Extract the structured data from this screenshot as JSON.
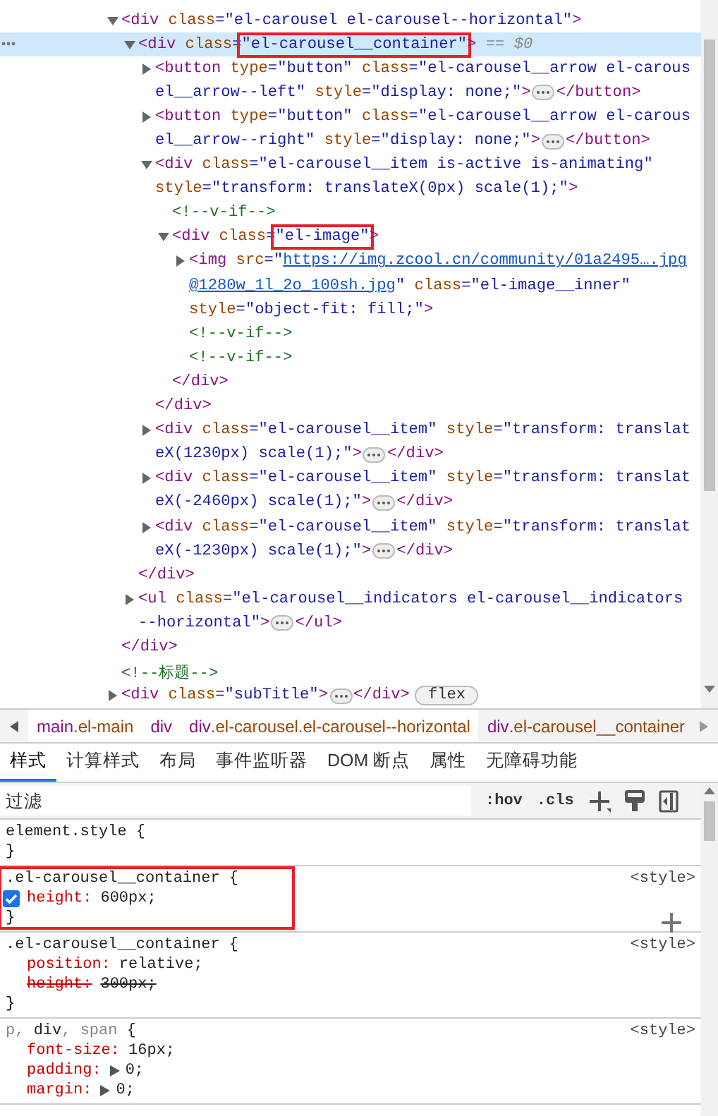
{
  "dom_tree": [
    {
      "kind": "element",
      "selected": false,
      "expanded": true,
      "lines": [
        [
          {
            "kind": "tag",
            "text": "<div"
          },
          {
            "kind": "attr",
            "text": " class"
          },
          {
            "kind": "value",
            "text": "=\"el-carousel el-carousel--horizontal\""
          },
          {
            "kind": "tag",
            "text": ">"
          }
        ]
      ],
      "children": [
        {
          "kind": "element",
          "selected": true,
          "expanded": true,
          "lines": [
            [
              {
                "kind": "tag",
                "text": "<div"
              },
              {
                "kind": "attr",
                "text": " class"
              },
              {
                "kind": "value",
                "text": "="
              },
              {
                "kind": "value",
                "text": "\"el-carousel__container\"",
                "outlined": true
              },
              {
                "kind": "tag",
                "text": ">"
              },
              {
                "kind": "marker",
                "text": " == $0"
              }
            ]
          ],
          "children": [
            {
              "kind": "element",
              "selected": false,
              "expanded": false,
              "lines": [
                [
                  {
                    "kind": "tag",
                    "text": "<button"
                  },
                  {
                    "kind": "attr",
                    "text": " type"
                  },
                  {
                    "kind": "value",
                    "text": "=\"button\""
                  },
                  {
                    "kind": "attr",
                    "text": " class"
                  },
                  {
                    "kind": "value",
                    "text": "=\"el-carousel__arrow el-carous"
                  }
                ],
                [
                  {
                    "kind": "value",
                    "text": "el__arrow--left\""
                  },
                  {
                    "kind": "attr",
                    "text": " style"
                  },
                  {
                    "kind": "value",
                    "text": "=\"display: none;\""
                  },
                  {
                    "kind": "tag",
                    "text": ">"
                  },
                  {
                    "kind": "ellipsis"
                  },
                  {
                    "kind": "tag",
                    "text": "</button>"
                  }
                ]
              ]
            },
            {
              "kind": "element",
              "selected": false,
              "expanded": false,
              "lines": [
                [
                  {
                    "kind": "tag",
                    "text": "<button"
                  },
                  {
                    "kind": "attr",
                    "text": " type"
                  },
                  {
                    "kind": "value",
                    "text": "=\"button\""
                  },
                  {
                    "kind": "attr",
                    "text": " class"
                  },
                  {
                    "kind": "value",
                    "text": "=\"el-carousel__arrow el-carous"
                  }
                ],
                [
                  {
                    "kind": "value",
                    "text": "el__arrow--right\""
                  },
                  {
                    "kind": "attr",
                    "text": " style"
                  },
                  {
                    "kind": "value",
                    "text": "=\"display: none;\""
                  },
                  {
                    "kind": "tag",
                    "text": ">"
                  },
                  {
                    "kind": "ellipsis"
                  },
                  {
                    "kind": "tag",
                    "text": "</button>"
                  }
                ]
              ]
            },
            {
              "kind": "element",
              "selected": false,
              "expanded": true,
              "lines": [
                [
                  {
                    "kind": "tag",
                    "text": "<div"
                  },
                  {
                    "kind": "attr",
                    "text": " class"
                  },
                  {
                    "kind": "value",
                    "text": "=\"el-carousel__item is-active is-animating\""
                  }
                ],
                [
                  {
                    "kind": "attr",
                    "text": "style"
                  },
                  {
                    "kind": "value",
                    "text": "=\"transform: translateX(0px) scale(1);\""
                  },
                  {
                    "kind": "tag",
                    "text": ">"
                  }
                ]
              ],
              "children": [
                {
                  "kind": "comment",
                  "selected": false,
                  "lines": [
                    [
                      {
                        "kind": "comment",
                        "text": "<!--v-if-->"
                      }
                    ]
                  ]
                },
                {
                  "kind": "element",
                  "selected": false,
                  "expanded": true,
                  "lines": [
                    [
                      {
                        "kind": "tag",
                        "text": "<div"
                      },
                      {
                        "kind": "attr",
                        "text": " class"
                      },
                      {
                        "kind": "value",
                        "text": "="
                      },
                      {
                        "kind": "value",
                        "text": "\"el-image\"",
                        "outlined": true
                      },
                      {
                        "kind": "tag",
                        "text": ">"
                      }
                    ]
                  ],
                  "children": [
                    {
                      "kind": "element",
                      "selected": false,
                      "expanded": false,
                      "lines": [
                        [
                          {
                            "kind": "tag",
                            "text": "<img"
                          },
                          {
                            "kind": "attr",
                            "text": " src"
                          },
                          {
                            "kind": "value",
                            "text": "=\""
                          },
                          {
                            "kind": "link",
                            "text": "https://img.zcool.cn/community/01a2495….jpg"
                          }
                        ],
                        [
                          {
                            "kind": "link",
                            "text": "@1280w_1l_2o_100sh.jpg"
                          },
                          {
                            "kind": "value",
                            "text": "\""
                          },
                          {
                            "kind": "attr",
                            "text": " class"
                          },
                          {
                            "kind": "value",
                            "text": "=\"el-image__inner\""
                          }
                        ],
                        [
                          {
                            "kind": "attr",
                            "text": "style"
                          },
                          {
                            "kind": "value",
                            "text": "=\"object-fit: fill;\""
                          },
                          {
                            "kind": "tag",
                            "text": ">"
                          }
                        ]
                      ]
                    },
                    {
                      "kind": "comment",
                      "selected": false,
                      "lines": [
                        [
                          {
                            "kind": "comment",
                            "text": "<!--v-if-->"
                          }
                        ]
                      ]
                    },
                    {
                      "kind": "comment",
                      "selected": false,
                      "lines": [
                        [
                          {
                            "kind": "comment",
                            "text": "<!--v-if-->"
                          }
                        ]
                      ]
                    }
                  ],
                  "closing": [
                    {
                      "kind": "tag",
                      "text": "</div>"
                    }
                  ]
                }
              ],
              "closing": [
                {
                  "kind": "tag",
                  "text": "</div>"
                }
              ]
            },
            {
              "kind": "element",
              "selected": false,
              "expanded": false,
              "lines": [
                [
                  {
                    "kind": "tag",
                    "text": "<div"
                  },
                  {
                    "kind": "attr",
                    "text": " class"
                  },
                  {
                    "kind": "value",
                    "text": "=\"el-carousel__item\""
                  },
                  {
                    "kind": "attr",
                    "text": " style"
                  },
                  {
                    "kind": "value",
                    "text": "=\"transform: translat"
                  }
                ],
                [
                  {
                    "kind": "value",
                    "text": "eX(1230px) scale(1);\""
                  },
                  {
                    "kind": "tag",
                    "text": ">"
                  },
                  {
                    "kind": "ellipsis"
                  },
                  {
                    "kind": "tag",
                    "text": "</div>"
                  }
                ]
              ]
            },
            {
              "kind": "element",
              "selected": false,
              "expanded": false,
              "lines": [
                [
                  {
                    "kind": "tag",
                    "text": "<div"
                  },
                  {
                    "kind": "attr",
                    "text": " class"
                  },
                  {
                    "kind": "value",
                    "text": "=\"el-carousel__item\""
                  },
                  {
                    "kind": "attr",
                    "text": " style"
                  },
                  {
                    "kind": "value",
                    "text": "=\"transform: translat"
                  }
                ],
                [
                  {
                    "kind": "value",
                    "text": "eX(-2460px) scale(1);\""
                  },
                  {
                    "kind": "tag",
                    "text": ">"
                  },
                  {
                    "kind": "ellipsis"
                  },
                  {
                    "kind": "tag",
                    "text": "</div>"
                  }
                ]
              ]
            },
            {
              "kind": "element",
              "selected": false,
              "expanded": false,
              "lines": [
                [
                  {
                    "kind": "tag",
                    "text": "<div"
                  },
                  {
                    "kind": "attr",
                    "text": " class"
                  },
                  {
                    "kind": "value",
                    "text": "=\"el-carousel__item\""
                  },
                  {
                    "kind": "attr",
                    "text": " style"
                  },
                  {
                    "kind": "value",
                    "text": "=\"transform: translat"
                  }
                ],
                [
                  {
                    "kind": "value",
                    "text": "eX(-1230px) scale(1);\""
                  },
                  {
                    "kind": "tag",
                    "text": ">"
                  },
                  {
                    "kind": "ellipsis"
                  },
                  {
                    "kind": "tag",
                    "text": "</div>"
                  }
                ]
              ]
            }
          ],
          "closing": [
            {
              "kind": "tag",
              "text": "</div>"
            }
          ]
        },
        {
          "kind": "element",
          "selected": false,
          "expanded": false,
          "lines": [
            [
              {
                "kind": "tag",
                "text": "<ul"
              },
              {
                "kind": "attr",
                "text": " class"
              },
              {
                "kind": "value",
                "text": "=\"el-carousel__indicators el-carousel__indicators"
              }
            ],
            [
              {
                "kind": "value",
                "text": "--horizontal\""
              },
              {
                "kind": "tag",
                "text": ">"
              },
              {
                "kind": "ellipsis"
              },
              {
                "kind": "tag",
                "text": "</ul>"
              }
            ]
          ]
        }
      ],
      "closing": [
        {
          "kind": "tag",
          "text": "</div>"
        }
      ]
    },
    {
      "kind": "comment",
      "selected": false,
      "lines": [
        [
          {
            "kind": "comment",
            "text": "<!--标题-->"
          }
        ]
      ]
    },
    {
      "kind": "element",
      "selected": false,
      "expanded": false,
      "lines": [
        [
          {
            "kind": "tag",
            "text": "<div"
          },
          {
            "kind": "attr",
            "text": " class"
          },
          {
            "kind": "value",
            "text": "=\"subTitle\""
          },
          {
            "kind": "tag",
            "text": ">"
          },
          {
            "kind": "ellipsis"
          },
          {
            "kind": "tag",
            "text": "</div>"
          },
          {
            "kind": "badge",
            "text": "flex"
          }
        ]
      ]
    }
  ],
  "breadcrumbs": [
    {
      "tag": "main",
      "classes": ".el-main",
      "selected": false
    },
    {
      "tag": "div",
      "selected": false
    },
    {
      "tag": "div",
      "classes": ".el-carousel.el-carousel--horizontal",
      "selected": false
    },
    {
      "tag": "div",
      "classes": ".el-carousel__container",
      "selected": true
    }
  ],
  "tabs": [
    {
      "label": "样式",
      "selected": true
    },
    {
      "label": "计算样式",
      "selected": false
    },
    {
      "label": "布局",
      "selected": false
    },
    {
      "label": "事件监听器",
      "selected": false
    },
    {
      "label": "DOM 断点",
      "selected": false
    },
    {
      "label": "属性",
      "selected": false
    },
    {
      "label": "无障碍功能",
      "selected": false
    }
  ],
  "filter": {
    "placeholder": "过滤",
    "hov": ":hov",
    "cls": ".cls"
  },
  "rules": [
    {
      "header": [
        {
          "text": "element.style",
          "matched": true
        },
        {
          "text": " {",
          "matched": true
        }
      ],
      "outlined": false,
      "hovered": false,
      "footer": "}"
    },
    {
      "header": [
        {
          "text": ".el-carousel__container",
          "matched": true
        },
        {
          "text": " {",
          "matched": true
        }
      ],
      "source": "<style>",
      "outlined": true,
      "hovered": true,
      "properties": [
        {
          "name": "height:",
          "value": "600px;",
          "hovered": true,
          "checked": true,
          "struck": false,
          "expandable": false
        }
      ],
      "footer": "}"
    },
    {
      "header": [
        {
          "text": ".el-carousel__container",
          "matched": true
        },
        {
          "text": " {",
          "matched": true
        }
      ],
      "source": "<style>",
      "outlined": false,
      "hovered": false,
      "properties": [
        {
          "name": "position:",
          "value": "relative;",
          "hovered": false,
          "checked": true,
          "struck": false,
          "expandable": false
        },
        {
          "name": "height:",
          "value": "300px;",
          "hovered": false,
          "checked": true,
          "struck": true,
          "expandable": false
        }
      ],
      "footer": "}"
    },
    {
      "header": [
        {
          "text": "p, ",
          "matched": false
        },
        {
          "text": "div",
          "matched": true
        },
        {
          "text": ", span",
          "matched": false
        },
        {
          "text": " {",
          "matched": true
        }
      ],
      "source": "<style>",
      "outlined": false,
      "hovered": false,
      "properties": [
        {
          "name": "font-size:",
          "value": "16px;",
          "hovered": false,
          "checked": true,
          "struck": false,
          "expandable": false
        },
        {
          "name": "padding:",
          "value": "0;",
          "hovered": false,
          "checked": true,
          "struck": false,
          "expandable": true
        },
        {
          "name": "margin:",
          "value": "0;",
          "hovered": false,
          "checked": true,
          "struck": false,
          "expandable": true
        }
      ]
    }
  ]
}
